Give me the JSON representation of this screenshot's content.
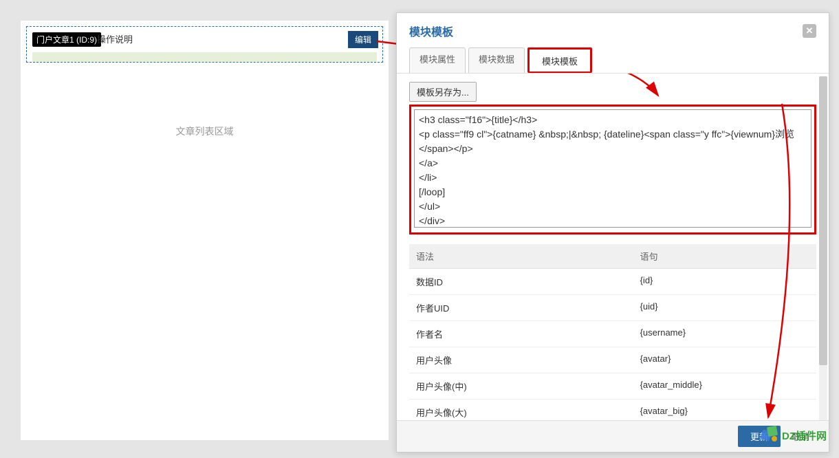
{
  "left": {
    "module_tag": "门户文章1 (ID:9)",
    "module_title_suffix": "操作说明",
    "edit_button": "编辑",
    "placeholder": "文章列表区域"
  },
  "modal": {
    "title": "模块模板",
    "tabs": {
      "attr": "模块属性",
      "data": "模块数据",
      "template": "模块模板"
    },
    "save_as": "模板另存为...",
    "textarea_value": "<h3 class=\"f16\">{title}</h3>\n<p class=\"ff9 cl\">{catname} &nbsp;|&nbsp; {dateline}<span class=\"y ffc\">{viewnum}浏览</span></p>\n</a>\n</li>\n[/loop]\n</ul>\n</div>",
    "ref_header": {
      "syntax": "语法",
      "statement": "语句"
    },
    "ref_rows": [
      {
        "label": "数据ID",
        "code": "{id}"
      },
      {
        "label": "作者UID",
        "code": "{uid}"
      },
      {
        "label": "作者名",
        "code": "{username}"
      },
      {
        "label": "用户头像",
        "code": "{avatar}"
      },
      {
        "label": "用户头像(中)",
        "code": "{avatar_middle}"
      },
      {
        "label": "用户头像(大)",
        "code": "{avatar_big}"
      }
    ],
    "footer": {
      "update": "更新",
      "cancel": "取消"
    }
  },
  "watermark": "DZ插件网"
}
